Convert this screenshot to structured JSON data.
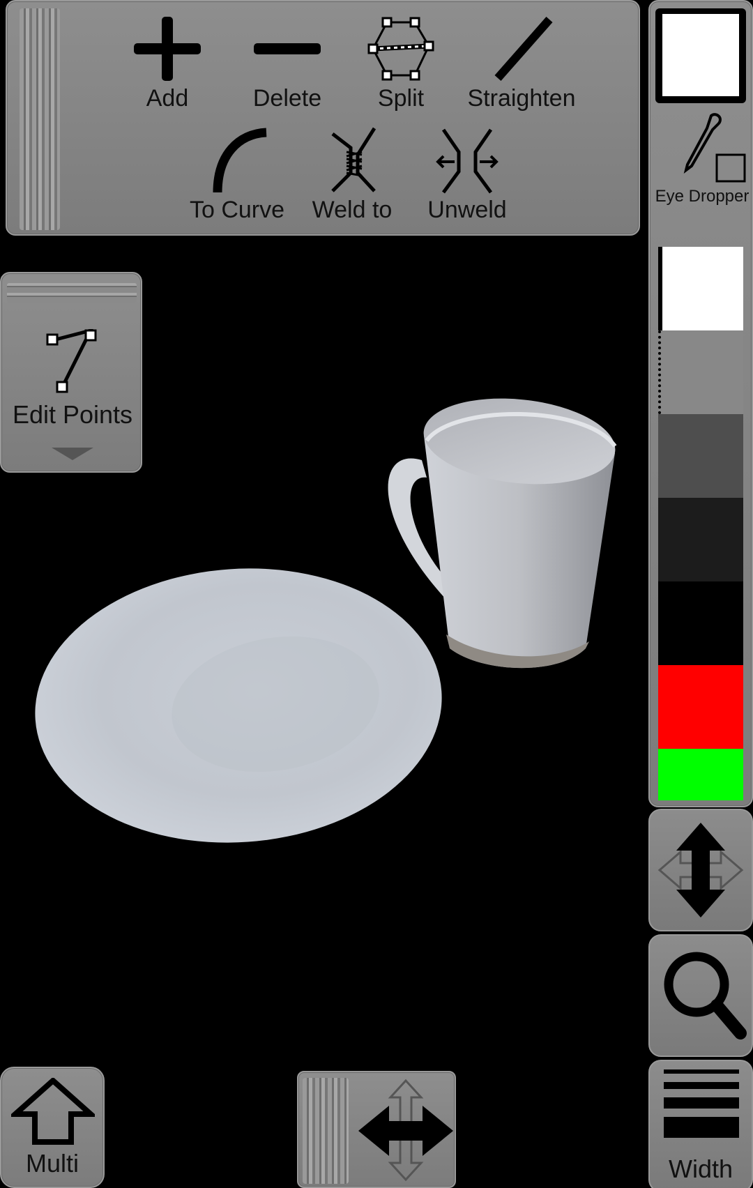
{
  "toolbar": {
    "row1": [
      {
        "label": "Add",
        "icon": "plus-icon"
      },
      {
        "label": "Delete",
        "icon": "minus-icon"
      },
      {
        "label": "Split",
        "icon": "split-icon"
      },
      {
        "label": "Straighten",
        "icon": "straight-line-icon"
      }
    ],
    "row2": [
      {
        "label": "To Curve",
        "icon": "curve-icon"
      },
      {
        "label": "Weld to",
        "icon": "weld-icon"
      },
      {
        "label": "Unweld",
        "icon": "unweld-icon"
      }
    ]
  },
  "mode_panel": {
    "label": "Edit Points",
    "icon": "edit-points-icon"
  },
  "right_panel": {
    "current_color": "#ffffff",
    "eye_dropper_label": "Eye Dropper",
    "palette": [
      "#ffffff",
      "#888888",
      "#4e4e4e",
      "#1c1c1c",
      "#000000",
      "#ff0000",
      "#00ff00"
    ]
  },
  "bottom": {
    "multi_label": "Multi",
    "width_label": "Width"
  }
}
